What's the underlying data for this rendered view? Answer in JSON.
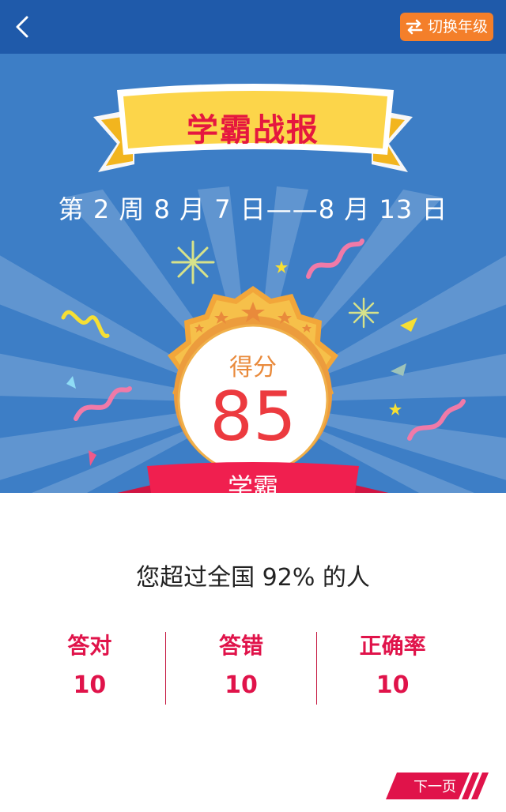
{
  "header": {
    "back_icon": "chevron-left-icon",
    "switch_icon": "swap-arrows-icon",
    "switch_label": "切换年级"
  },
  "report": {
    "title": "学霸战报",
    "date_range": "第 2 周   8 月 7 日——8 月 13 日",
    "score_label": "得分",
    "score_value": "85",
    "rank_label": "学霸",
    "exceed_text": "您超过全国 92% 的人"
  },
  "stats": [
    {
      "label": "答对",
      "value": "10"
    },
    {
      "label": "答错",
      "value": "10"
    },
    {
      "label": "正确率",
      "value": "10"
    }
  ],
  "footer": {
    "next_label": "下一页"
  },
  "colors": {
    "nav_bg": "#1f5aaa",
    "hero_bg": "#3d7ec6",
    "accent_orange": "#f47f2a",
    "accent_red": "#e0134a",
    "badge_gold": "#f6c04a"
  }
}
